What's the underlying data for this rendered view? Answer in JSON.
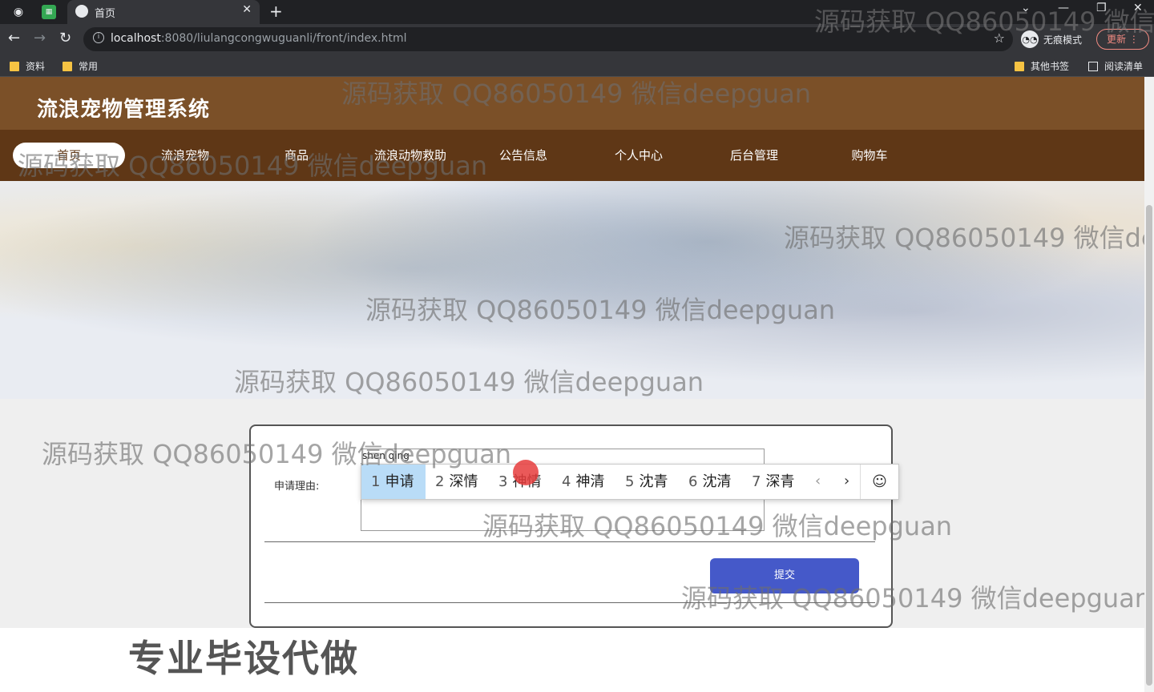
{
  "browser": {
    "tab_title": "首页",
    "url_host": "localhost",
    "url_path": ":8080/liulangcongwuguanli/front/index.html",
    "incognito_label": "无痕模式",
    "update_label": "更新",
    "bookmarks": [
      "资料",
      "常用"
    ],
    "bookmarks_right": [
      "其他书签",
      "阅读清单"
    ]
  },
  "site": {
    "title": "流浪宠物管理系统",
    "nav": [
      "首页",
      "流浪宠物",
      "商品",
      "流浪动物救助",
      "公告信息",
      "个人中心",
      "后台管理",
      "购物车"
    ]
  },
  "form": {
    "reason_label": "申请理由:",
    "submit_label": "提交"
  },
  "ime": {
    "pinyin": "shen qing",
    "candidates": [
      {
        "num": "1",
        "text": "申请"
      },
      {
        "num": "2",
        "text": "深情"
      },
      {
        "num": "3",
        "text": "神情"
      },
      {
        "num": "4",
        "text": "神清"
      },
      {
        "num": "5",
        "text": "沈青"
      },
      {
        "num": "6",
        "text": "沈清"
      },
      {
        "num": "7",
        "text": "深青"
      }
    ],
    "selected_index": 0
  },
  "promo_text": "专业毕设代做",
  "watermark": "源码获取 QQ86050149 微信deepguan"
}
